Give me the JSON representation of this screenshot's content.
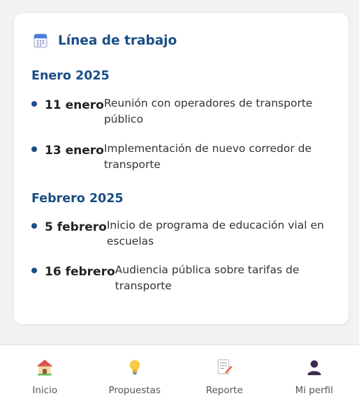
{
  "timeline": {
    "title": "Línea de trabajo",
    "icon": "calendar-icon",
    "months": [
      {
        "label": "Enero 2025",
        "events": [
          {
            "date": "11 enero",
            "text": "Reunión con operadores de transporte público"
          },
          {
            "date": "13 enero",
            "text": "Implementación de nuevo corredor de transporte"
          }
        ]
      },
      {
        "label": "Febrero 2025",
        "events": [
          {
            "date": "5 febrero",
            "text": "Inicio de programa de educación vial en escuelas"
          },
          {
            "date": "16 febrero",
            "text": "Audiencia pública sobre tarifas de transporte"
          }
        ]
      }
    ]
  },
  "nav": {
    "items": [
      {
        "label": "Inicio",
        "icon": "house-icon"
      },
      {
        "label": "Propuestas",
        "icon": "lightbulb-icon"
      },
      {
        "label": "Reporte",
        "icon": "memo-icon"
      },
      {
        "label": "Mi perfil",
        "icon": "user-icon"
      }
    ]
  },
  "colors": {
    "accent": "#1a4e85",
    "background": "#f2f2f2",
    "card": "#ffffff"
  }
}
